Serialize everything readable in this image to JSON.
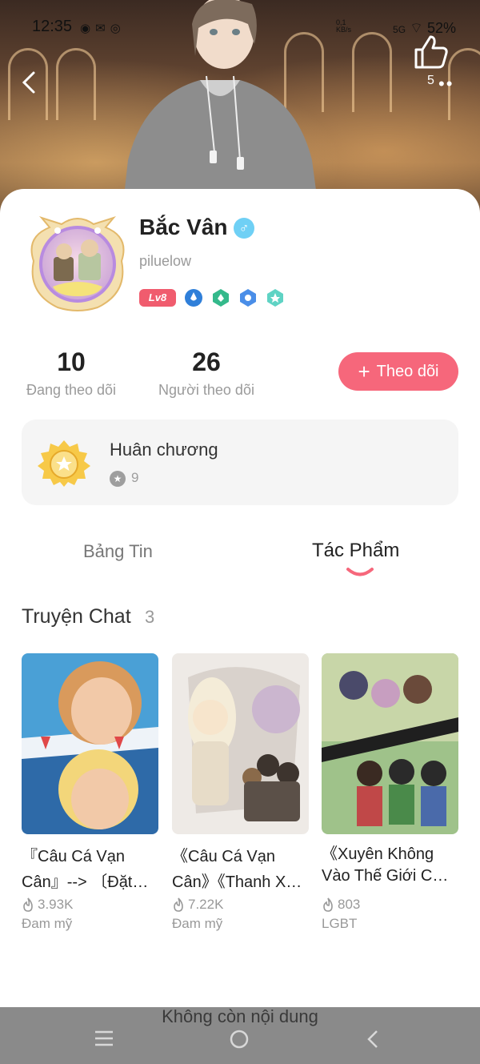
{
  "status_bar": {
    "time": "12:35",
    "network_speed": "0,1",
    "network_unit": "KB/s",
    "signal": "5G",
    "battery": "52%"
  },
  "header": {
    "like_count": "5"
  },
  "profile": {
    "name": "Bắc Vân",
    "gender_symbol": "♂",
    "username": "piluelow",
    "level": "Lv8",
    "following_count": "10",
    "following_label": "Đang theo dõi",
    "followers_count": "26",
    "followers_label": "Người theo dõi",
    "follow_button_label": "Theo dõi"
  },
  "medals": {
    "title": "Huân chương",
    "count": "9"
  },
  "tabs": [
    {
      "label": "Bảng Tin",
      "active": false
    },
    {
      "label": "Tác Phẩm",
      "active": true
    }
  ],
  "section": {
    "title": "Truyện Chat",
    "count": "3"
  },
  "stories": [
    {
      "title": "『Câu Cá Vạn Cân』--> 〔Đặt Đơ…",
      "views": "3.93K",
      "tag": "Đam mỹ"
    },
    {
      "title": "《Câu Cá Vạn Cân》《Thanh X…",
      "views": "7.22K",
      "tag": "Đam mỹ"
    },
    {
      "title": "《Xuyên Không Vào Thế Giới C…",
      "views": "803",
      "tag": "LGBT"
    }
  ],
  "footer": {
    "end_text": "Không còn nội dung"
  },
  "colors": {
    "accent": "#f6677b",
    "level_badge": "#f05c6e",
    "gender_badge": "#6fd0f5",
    "card_bg": "#f5f5f5",
    "nav_bar": "#8a8a8a"
  }
}
